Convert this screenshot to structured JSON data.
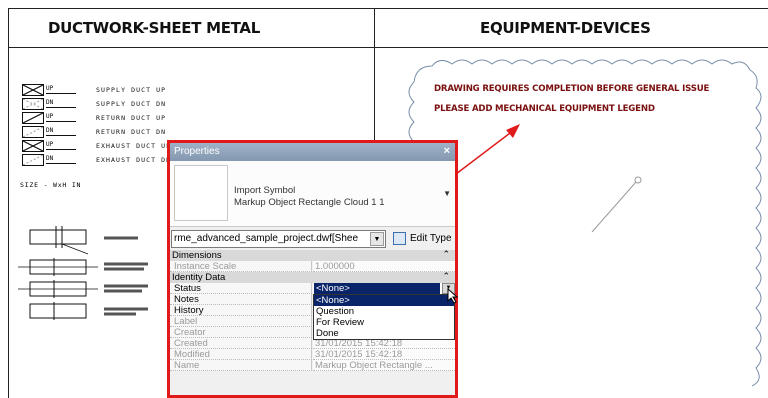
{
  "sheet": {
    "left_title": "DUCTWORK-SHEET METAL",
    "right_title": "EQUIPMENT-DEVICES",
    "legend": [
      {
        "tag": "UP",
        "text": "SUPPLY DUCT UP"
      },
      {
        "tag": "DN",
        "text": "SUPPLY DUCT DN"
      },
      {
        "tag": "UP",
        "text": "RETURN DUCT UP"
      },
      {
        "tag": "DN",
        "text": "RETURN DUCT DN"
      },
      {
        "tag": "UP",
        "text": "EXHAUST DUCT UP"
      },
      {
        "tag": "DN",
        "text": "EXHAUST DUCT DN"
      }
    ],
    "size_note": "SIZE - WxH IN",
    "markup_lines": [
      "DRAWING REQUIRES COMPLETION BEFORE GENERAL ISSUE",
      "PLEASE ADD MECHANICAL EQUIPMENT LEGEND"
    ],
    "markup_color": "#7a1010",
    "callout_color": "#e0191b"
  },
  "properties": {
    "title": "Properties",
    "close_label": "×",
    "type_family": "Import Symbol",
    "type_name": "Markup Object Rectangle Cloud 1 1",
    "instance_filter": "rme_advanced_sample_project.dwf[Shee",
    "edit_type_label": "Edit Type",
    "groups": {
      "dimensions": "Dimensions",
      "identity": "Identity Data"
    },
    "rows": {
      "instance_scale": {
        "name": "Instance Scale",
        "value": "1.000000"
      },
      "status": {
        "name": "Status",
        "value": "<None>"
      },
      "notes": {
        "name": "Notes"
      },
      "history": {
        "name": "History"
      },
      "label": {
        "name": "Label"
      },
      "creator": {
        "name": "Creator"
      },
      "created": {
        "name": "Created",
        "value": "31/01/2015 15:42:18"
      },
      "modified": {
        "name": "Modified",
        "value": "31/01/2015 15:42:18"
      },
      "name": {
        "name": "Name",
        "value": "Markup Object Rectangle ..."
      }
    },
    "status_options": [
      "<None>",
      "Question",
      "For Review",
      "Done"
    ],
    "status_selected": "<None>",
    "border_color": "#e0191b"
  }
}
